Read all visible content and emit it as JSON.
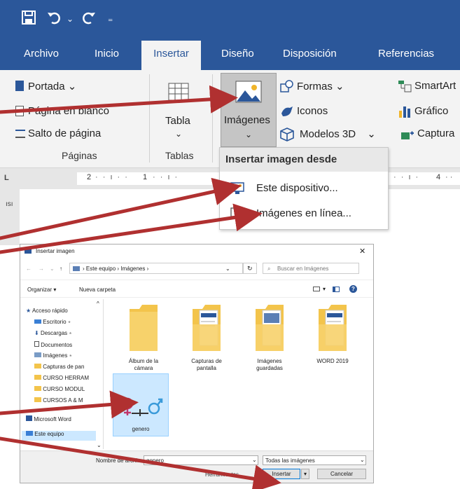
{
  "ribbon_tabs": [
    "Archivo",
    "Inicio",
    "Insertar",
    "Diseño",
    "Disposición",
    "Referencias"
  ],
  "pages_group": {
    "portada": "Portada",
    "pagina_blanco": "Página en blanco",
    "salto_pagina": "Salto de página",
    "label": "Páginas"
  },
  "tables_group": {
    "tabla": "Tabla",
    "label": "Tablas"
  },
  "illustrations": {
    "imagenes": "Imágenes",
    "formas": "Formas",
    "iconos": "Iconos",
    "modelos3d": "Modelos 3D",
    "smartart": "SmartArt",
    "grafico": "Gráfico",
    "captura": "Captura"
  },
  "dropdown": {
    "header": "Insertar imagen desde",
    "item1": "Este dispositivo...",
    "item2": "Imágenes en línea..."
  },
  "ruler_numbers": [
    "2",
    "1",
    "4"
  ],
  "dialog": {
    "title": "Insertar imagen",
    "breadcrumb": "› Este equipo › Imágenes ›",
    "search_placeholder": "Buscar en Imágenes",
    "organizar": "Organizar ▾",
    "nueva_carpeta": "Nueva carpeta",
    "nav_items": [
      "Acceso rápido",
      "Escritorio",
      "Descargas",
      "Documentos",
      "Imágenes",
      "Capturas de pan",
      "CURSO HERRAM",
      "CURSO MODUL",
      "CURSOS A & M",
      "Microsoft Word",
      "Este equipo"
    ],
    "folders": [
      {
        "line1": "Álbum de la",
        "line2": "cámara"
      },
      {
        "line1": "Capturas de",
        "line2": "pantalla"
      },
      {
        "line1": "Imágenes",
        "line2": "guardadas"
      },
      {
        "line1": "WORD 2019",
        "line2": ""
      }
    ],
    "file_name": "genero",
    "filename_label": "Nombre de archivo:",
    "filename_value": "genero",
    "filter": "Todas las imágenes",
    "herramientas": "Herramientas",
    "insertar": "Insertar",
    "cancelar": "Cancelar"
  },
  "colors": {
    "word_blue": "#2b579a",
    "arrow_red": "#b03030",
    "selection": "#cce8ff"
  }
}
